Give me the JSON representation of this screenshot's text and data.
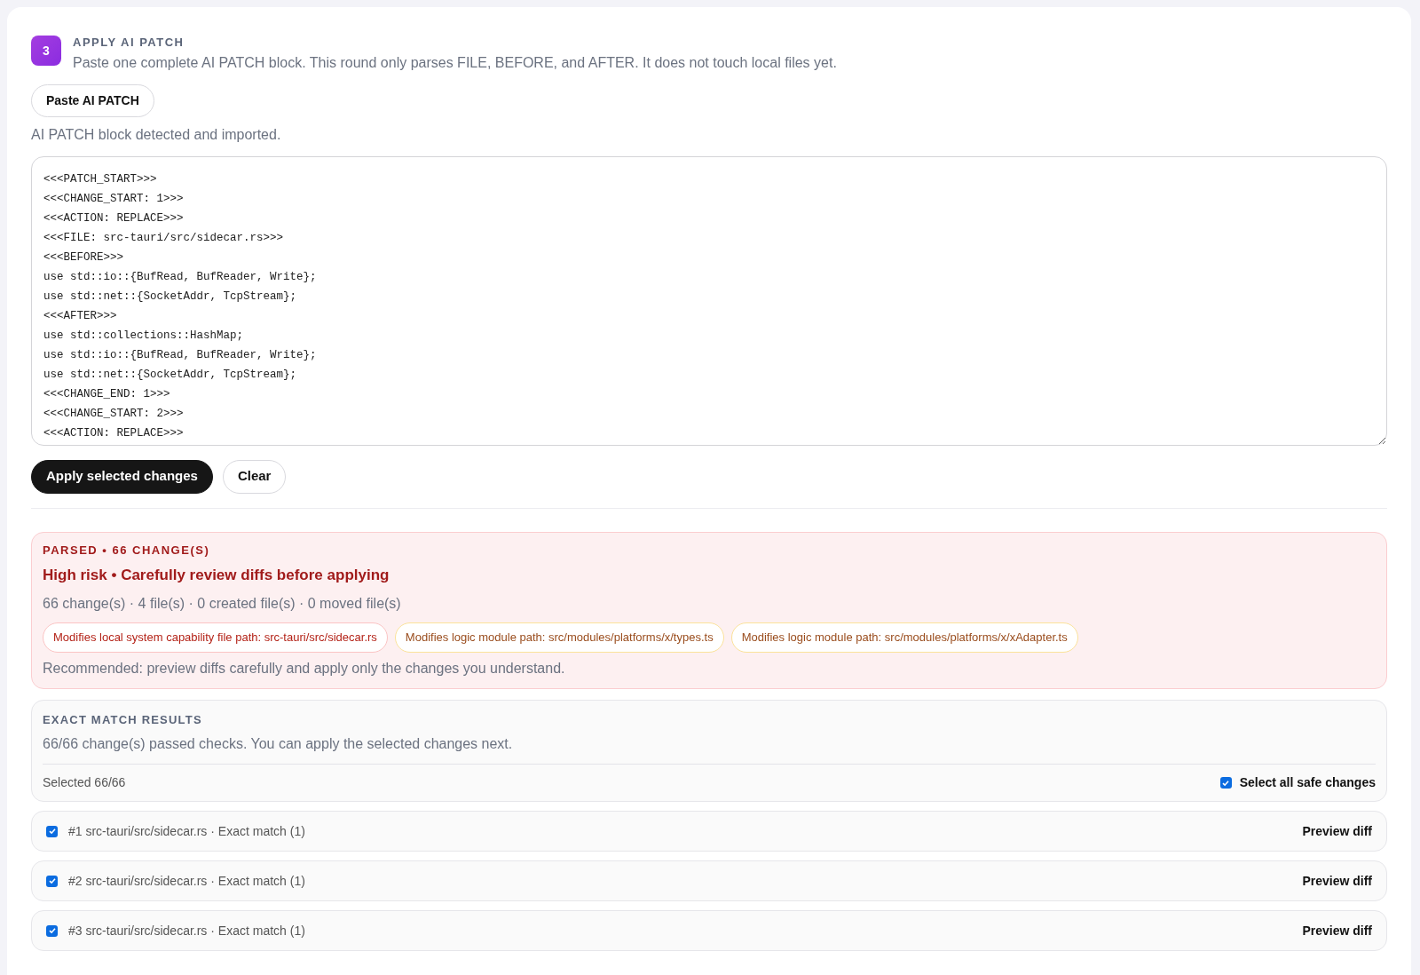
{
  "step": {
    "number": "3",
    "title": "APPLY AI PATCH",
    "description": "Paste one complete AI PATCH block. This round only parses FILE, BEFORE, and AFTER. It does not touch local files yet."
  },
  "paste_button": "Paste AI PATCH",
  "status": "AI PATCH block detected and imported.",
  "patch_text": "<<<PATCH_START>>>\n<<<CHANGE_START: 1>>>\n<<<ACTION: REPLACE>>>\n<<<FILE: src-tauri/src/sidecar.rs>>>\n<<<BEFORE>>>\nuse std::io::{BufRead, BufReader, Write};\nuse std::net::{SocketAddr, TcpStream};\n<<<AFTER>>>\nuse std::collections::HashMap;\nuse std::io::{BufRead, BufReader, Write};\nuse std::net::{SocketAddr, TcpStream};\n<<<CHANGE_END: 1>>>\n<<<CHANGE_START: 2>>>\n<<<ACTION: REPLACE>>>",
  "actions": [
    {
      "label": "Apply selected changes",
      "kind": "primary"
    },
    {
      "label": "Clear",
      "kind": "secondary"
    }
  ],
  "risk": {
    "heading": "PARSED • 66 CHANGE(S)",
    "title": "High risk • Carefully review diffs before applying",
    "summary": "66 change(s) · 4 file(s) · 0 created file(s) · 0 moved file(s)",
    "tags": [
      {
        "label": "Modifies local system capability file path: src-tauri/src/sidecar.rs",
        "kind": "system"
      },
      {
        "label": "Modifies logic module path: src/modules/platforms/x/types.ts",
        "kind": "logic"
      },
      {
        "label": "Modifies logic module path: src/modules/platforms/x/xAdapter.ts",
        "kind": "logic"
      }
    ],
    "recommendation": "Recommended: preview diffs carefully and apply only the changes you understand."
  },
  "results": {
    "heading": "EXACT MATCH RESULTS",
    "summary": "66/66 change(s) passed checks. You can apply the selected changes next.",
    "selected_count": "Selected 66/66",
    "select_all": {
      "label": "Select all safe changes",
      "checked": true
    }
  },
  "changes": [
    {
      "label": "#1 src-tauri/src/sidecar.rs · Exact match (1)",
      "checked": true,
      "action": "Preview diff"
    },
    {
      "label": "#2 src-tauri/src/sidecar.rs · Exact match (1)",
      "checked": true,
      "action": "Preview diff"
    },
    {
      "label": "#3 src-tauri/src/sidecar.rs · Exact match (1)",
      "checked": true,
      "action": "Preview diff"
    }
  ]
}
